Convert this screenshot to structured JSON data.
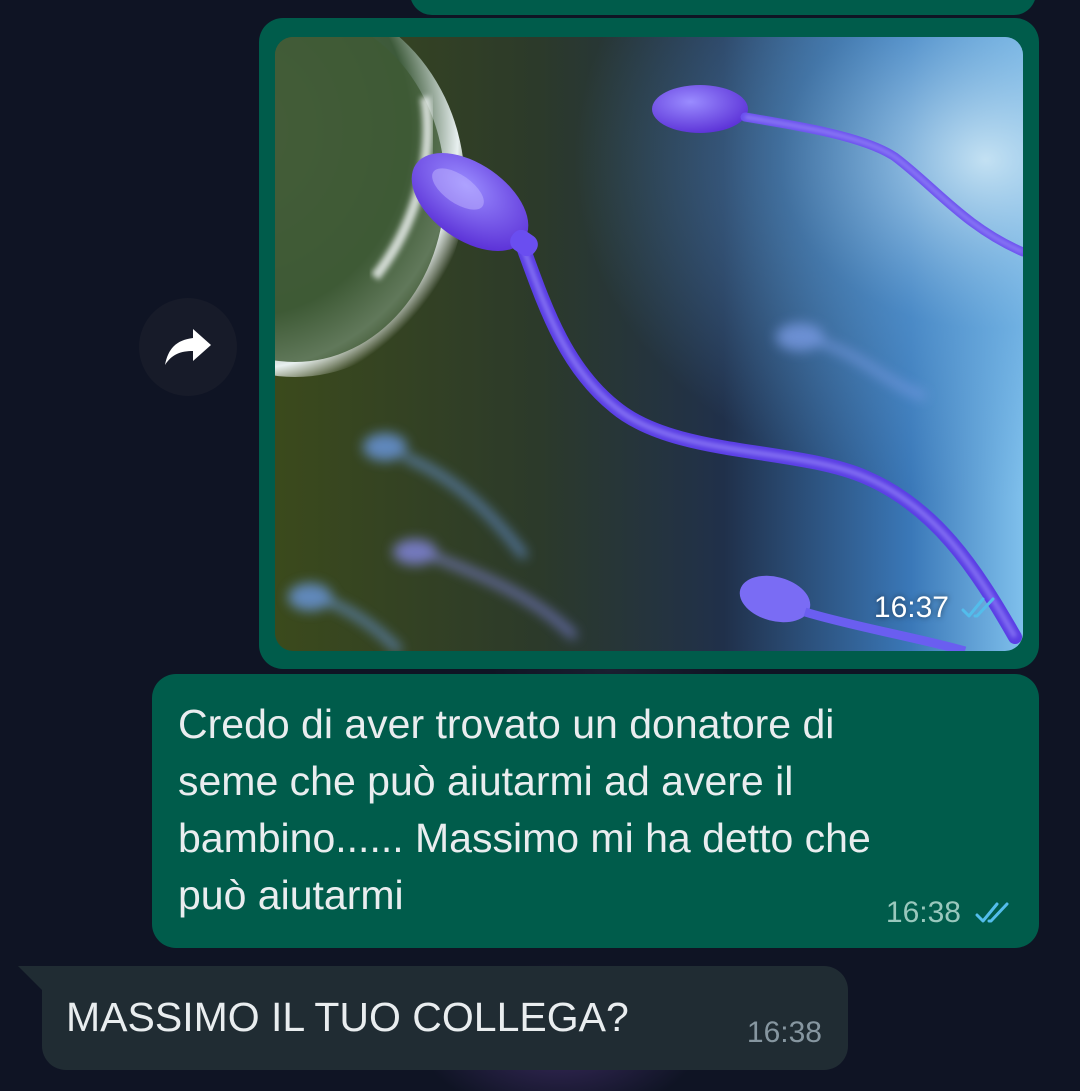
{
  "colors": {
    "chat_background": "#0f1424",
    "outgoing_bubble": "#005c4b",
    "incoming_bubble": "#202c33",
    "read_ticks": "#53bdeb",
    "message_text": "#e9edef"
  },
  "forward": {
    "icon": "forward-arrow-icon"
  },
  "messages": [
    {
      "type": "image",
      "direction": "outgoing",
      "time": "16:37",
      "status": "read"
    },
    {
      "type": "text",
      "direction": "outgoing",
      "text": "Credo di aver trovato un donatore di\nseme che può aiutarmi ad avere il\nbambino...... Massimo mi ha detto che\npuò aiutarmi",
      "time": "16:38",
      "status": "read"
    },
    {
      "type": "text",
      "direction": "incoming",
      "text": "MASSIMO IL TUO COLLEGA?",
      "time": "16:38"
    }
  ]
}
